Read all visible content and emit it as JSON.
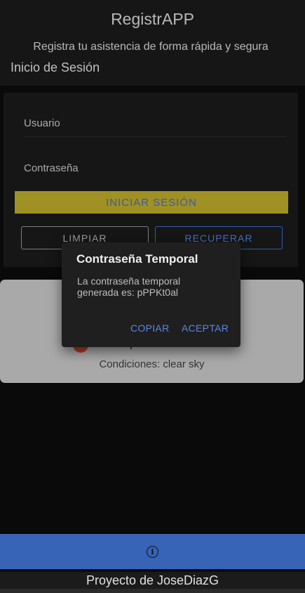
{
  "header": {
    "title": "RegistrAPP",
    "subtitle": "Registra tu asistencia de forma rápida y segura",
    "page_title": "Inicio de Sesión"
  },
  "login": {
    "username_placeholder": "Usuario",
    "password_placeholder": "Contraseña",
    "login_button": "INICIAR SESIÓN",
    "clear_button": "LIMPIAR",
    "recover_button": "RECUPERAR"
  },
  "weather": {
    "temperature": "Temperatura: 22 °C",
    "conditions": "Condiciones: clear sky"
  },
  "dialog": {
    "title": "Contraseña Temporal",
    "message": "La contraseña temporal generada es: pPPKt0al",
    "copy_button": "COPIAR",
    "accept_button": "ACEPTAR"
  },
  "footer": {
    "info_icon": "info-icon",
    "credit": "Proyecto de JoseDiazG"
  },
  "colors": {
    "accent_yellow": "#c2b12c",
    "primary_blue": "#3864b8",
    "link_blue": "#5a86e6"
  }
}
